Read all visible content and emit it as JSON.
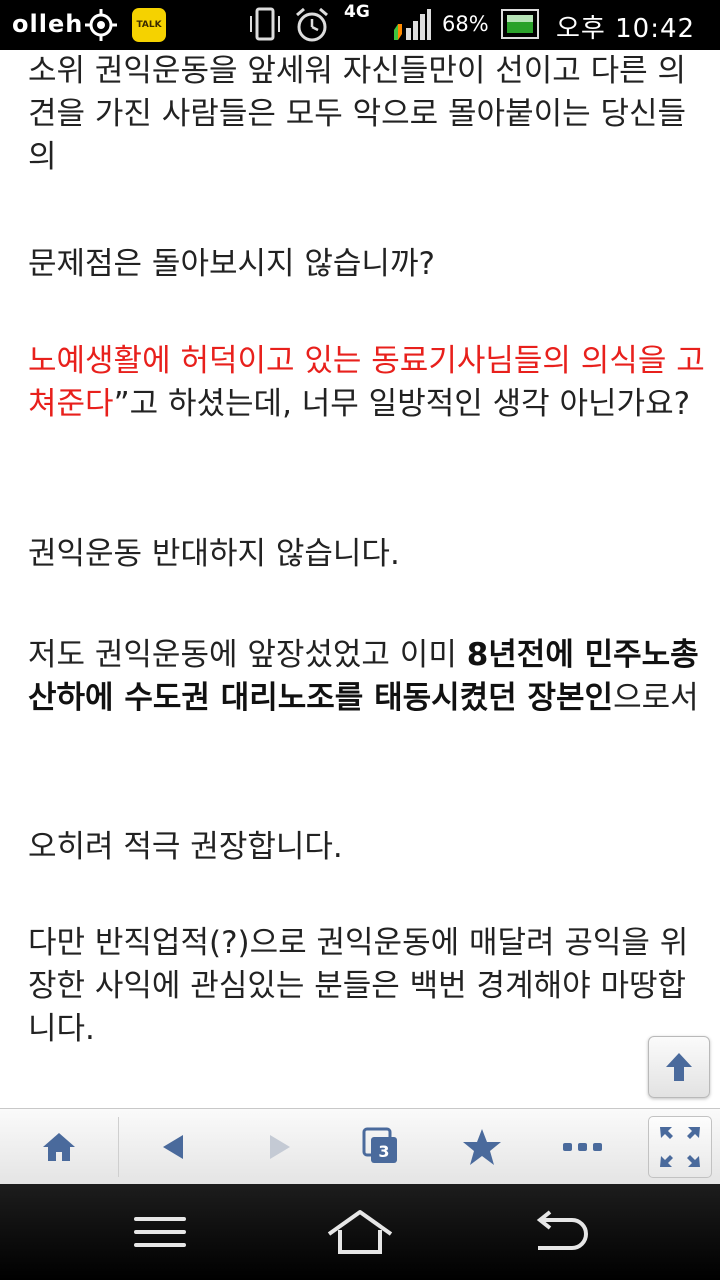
{
  "status_bar": {
    "carrier": "olleh",
    "kakaotalk_label": "TALK",
    "network": "4G",
    "battery_percent": "68%",
    "time": "오후 10:42"
  },
  "article": {
    "p1": "소위 권익운동을 앞세워 자신들만이 선이고 다른 의견을 가진 사람들은 모두 악으로 몰아붙이는 당신들의",
    "p2": "문제점은 돌아보시지 않습니까?",
    "p3_red": "노예생활에 허덕이고 있는 동료기사님들의 의식을 고쳐준다",
    "p3_rest": "”고 하셨는데, 너무 일방적인 생각 아닌가요?",
    "p4": "권익운동 반대하지 않습니다.",
    "p5_start": "저도 권익운동에 앞장섰었고 이미 ",
    "p5_bold": "8년전에 민주노총산하에 수도권 대리노조를 태동시켰던 장본인",
    "p5_end": "으로서",
    "p6": "오히려 적극 권장합니다.",
    "p7": "다만 반직업적(?)으로 권익운동에 매달려 공익을 위장한 사익에 관심있는 분들은 백번 경계해야 마땅합니다."
  },
  "toolbar": {
    "tab_count": "3"
  },
  "colors": {
    "highlight_red": "#e8201c",
    "toolbar_icon": "#4a6a9c"
  }
}
